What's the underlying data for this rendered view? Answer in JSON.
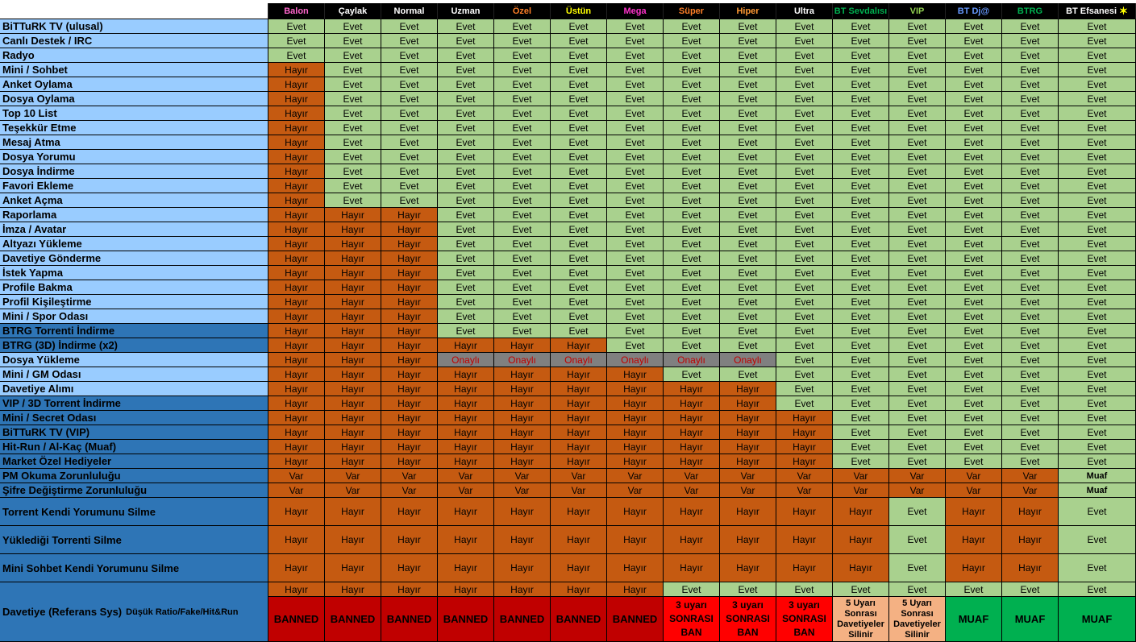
{
  "ranks": [
    {
      "name": "Balon",
      "color": "#ff66cc"
    },
    {
      "name": "Çaylak",
      "color": "#ffffff"
    },
    {
      "name": "Normal",
      "color": "#ffffff"
    },
    {
      "name": "Uzman",
      "color": "#ffffff"
    },
    {
      "name": "Özel",
      "color": "#ff7f27"
    },
    {
      "name": "Üstün",
      "color": "#ffff00"
    },
    {
      "name": "Mega",
      "color": "#ff33cc"
    },
    {
      "name": "Süper",
      "color": "#ff7f27"
    },
    {
      "name": "Hiper",
      "color": "#ff9933"
    },
    {
      "name": "Ultra",
      "color": "#ffffff"
    },
    {
      "name": "BT Sevdalısı",
      "color": "#00b050"
    },
    {
      "name": "VIP",
      "color": "#92d050"
    },
    {
      "name": "BT Dj@",
      "color": "#6699ff"
    },
    {
      "name": "BTRG",
      "color": "#00b050"
    },
    {
      "name": "BT Efsanesi",
      "color": "#ffffff",
      "star": "✶"
    }
  ],
  "values": {
    "E": "Evet",
    "H": "Hayır",
    "O": "Onaylı",
    "V": "Var",
    "M": "Muaf",
    "B": "BANNED",
    "U": "MUAF"
  },
  "multi": {
    "S": [
      "3 uyarı",
      "SONRASI",
      "BAN"
    ],
    "D": [
      "5 Uyarı",
      "Sonrası",
      "Davetiyeler",
      "Silinir"
    ]
  },
  "colors": {
    "evet": "#a9d18e",
    "hayir": "#c55a11",
    "onayli_bg": "#808080",
    "onayli_text": "#c00000",
    "banned": "#c00000",
    "ban3": "#ff0000",
    "uyari5": "#f4b183",
    "muaf_green": "#00b050"
  },
  "rows": [
    {
      "label": "BiTTuRK TV (ulusal)",
      "style": "light",
      "cells": "EEEEEEEEEEEEEEE"
    },
    {
      "label": "Canlı Destek / IRC",
      "style": "light",
      "cells": "EEEEEEEEEEEEEEE"
    },
    {
      "label": "Radyo",
      "style": "light",
      "cells": "EEEEEEEEEEEEEEE"
    },
    {
      "label": "Mini / Sohbet",
      "style": "light",
      "cells": "HEEEEEEEEEEEEEE"
    },
    {
      "label": "Anket Oylama",
      "style": "light",
      "cells": "HEEEEEEEEEEEEEE"
    },
    {
      "label": "Dosya Oylama",
      "style": "light",
      "cells": "HEEEEEEEEEEEEEE"
    },
    {
      "label": "Top 10 List",
      "style": "light",
      "cells": "HEEEEEEEEEEEEEE"
    },
    {
      "label": "Teşekkür Etme",
      "style": "light",
      "cells": "HEEEEEEEEEEEEEE"
    },
    {
      "label": "Mesaj Atma",
      "style": "light",
      "cells": "HEEEEEEEEEEEEEE"
    },
    {
      "label": "Dosya Yorumu",
      "style": "light",
      "cells": "HEEEEEEEEEEEEEE"
    },
    {
      "label": "Dosya İndirme",
      "style": "light",
      "cells": "HEEEEEEEEEEEEEE"
    },
    {
      "label": "Favori Ekleme",
      "style": "light",
      "cells": "HEEEEEEEEEEEEEE"
    },
    {
      "label": "Anket Açma",
      "style": "light",
      "cells": "HEEEEEEEEEEEEEE"
    },
    {
      "label": "Raporlama",
      "style": "light",
      "cells": "HHHEEEEEEEEEEEE"
    },
    {
      "label": "İmza / Avatar",
      "style": "light",
      "cells": "HHHEEEEEEEEEEEE"
    },
    {
      "label": "Altyazı Yükleme",
      "style": "light",
      "cells": "HHHEEEEEEEEEEEE"
    },
    {
      "label": "Davetiye Gönderme",
      "style": "light",
      "cells": "HHHEEEEEEEEEEEE"
    },
    {
      "label": "İstek Yapma",
      "style": "light",
      "cells": "HHHEEEEEEEEEEEE"
    },
    {
      "label": "Profile Bakma",
      "style": "light",
      "cells": "HHHEEEEEEEEEEEE"
    },
    {
      "label": "Profil Kişileştirme",
      "style": "light",
      "cells": "HHHEEEEEEEEEEEE"
    },
    {
      "label": "Mini / Spor Odası",
      "style": "light",
      "cells": "HHHEEEEEEEEEEEE"
    },
    {
      "label": "BTRG Torrenti İndirme",
      "style": "dark",
      "cells": "HHHEEEEEEEEEEEE"
    },
    {
      "label": "BTRG (3D) İndirme (x2)",
      "style": "dark",
      "cells": "HHHHHHEEEEEEEEE"
    },
    {
      "label": "Dosya Yükleme",
      "style": "light",
      "cells": "HHHOOOOOOEEEEEE"
    },
    {
      "label": "Mini / GM Odası",
      "style": "light",
      "cells": "HHHHHHHEEEEEEEE"
    },
    {
      "label": "Davetiye Alımı",
      "style": "light",
      "cells": "HHHHHHHHHEEEEEE"
    },
    {
      "label": "VIP / 3D Torrent İndirme",
      "style": "dark",
      "cells": "HHHHHHHHHEEEEEE"
    },
    {
      "label": "Mini / Secret Odası",
      "style": "dark",
      "cells": "HHHHHHHHHHEEEEE"
    },
    {
      "label": "BiTTuRK TV (VIP)",
      "style": "dark",
      "cells": "HHHHHHHHHHEEEEE"
    },
    {
      "label": "Hit-Run / Al-Kaç (Muaf)",
      "style": "dark",
      "cells": "HHHHHHHHHHEEEEE"
    },
    {
      "label": "Market Özel Hediyeler",
      "style": "dark",
      "cells": "HHHHHHHHHHEEEEE"
    },
    {
      "label": "PM Okuma Zorunluluğu",
      "style": "dark",
      "cells": "VVVVVVVVVVVVVVM"
    },
    {
      "label": "Şifre Değiştirme Zorunluluğu",
      "style": "dark",
      "cells": "VVVVVVVVVVVVVVM"
    },
    {
      "label": "Torrent Kendi  Yorumunu Silme",
      "style": "dark",
      "cells": "HHHHHHHHHHHEHHE"
    },
    {
      "label": "Yüklediği Torrenti Silme",
      "style": "dark",
      "cells": "HHHHHHHHHHHEHHE"
    },
    {
      "label": "Mini Sohbet Kendi  Yorumunu Silme",
      "style": "dark",
      "cells": "HHHHHHHHHHHEHHE"
    },
    {
      "label": "Davetiye (Referans Sys)",
      "sub": "Düşük Ratio/Fake/Hit&Run",
      "style": "dark",
      "cells": "HHHHHHHEEEEEEEE",
      "cells2": "BBBBBBBSSSDDUUU"
    }
  ]
}
